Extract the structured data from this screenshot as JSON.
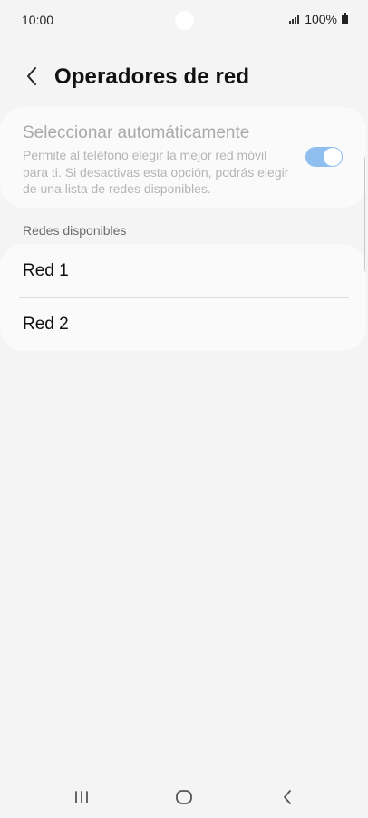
{
  "status_bar": {
    "time": "10:00",
    "battery_percent": "100%",
    "icons": [
      "signal-icon",
      "battery-icon"
    ]
  },
  "header": {
    "back_icon": "back-arrow-icon",
    "title": "Operadores de red"
  },
  "auto_select": {
    "title": "Seleccionar automáticamente",
    "description": "Permite al teléfono elegir la mejor red móvil para ti. Si desactivas esta opción, podrás elegir de una lista de redes disponibles.",
    "enabled": true,
    "toggle_color": "#8fbfee"
  },
  "networks": {
    "section_label": "Redes disponibles",
    "items": [
      {
        "label": "Red 1"
      },
      {
        "label": "Red 2"
      }
    ]
  },
  "nav_bar": {
    "icons": [
      "recent-apps-icon",
      "home-icon",
      "back-icon"
    ]
  }
}
